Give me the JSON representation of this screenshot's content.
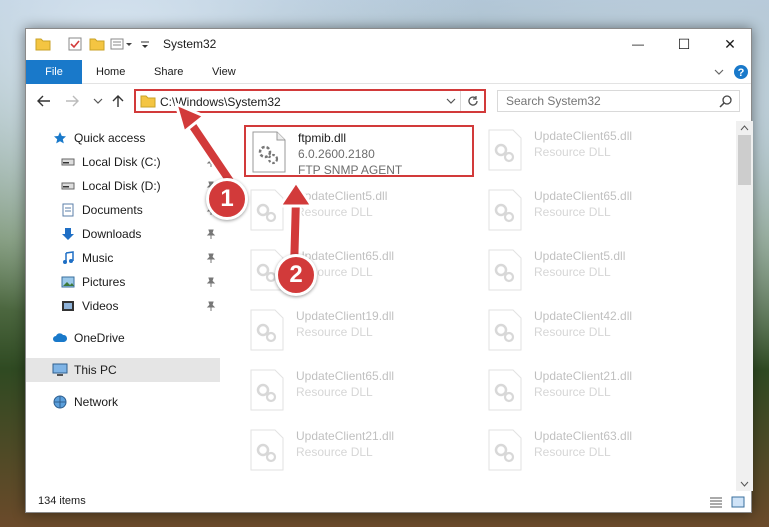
{
  "window": {
    "title": "System32",
    "minimize_glyph": "—",
    "maximize_glyph": "☐",
    "close_glyph": "✕"
  },
  "ribbon": {
    "tabs": [
      "File",
      "Home",
      "Share",
      "View"
    ]
  },
  "nav": {
    "address": "C:\\Windows\\System32",
    "search_placeholder": "Search System32"
  },
  "sidebar": {
    "items": [
      {
        "label": "Quick access",
        "icon": "star-icon"
      },
      {
        "label": "Local Disk (C:)",
        "icon": "drive-icon"
      },
      {
        "label": "Local Disk (D:)",
        "icon": "drive-icon"
      },
      {
        "label": "Documents",
        "icon": "documents-icon"
      },
      {
        "label": "Downloads",
        "icon": "download-icon"
      },
      {
        "label": "Music",
        "icon": "music-icon"
      },
      {
        "label": "Pictures",
        "icon": "pictures-icon"
      },
      {
        "label": "Videos",
        "icon": "videos-icon"
      },
      {
        "label": "OneDrive",
        "icon": "cloud-icon"
      },
      {
        "label": "This PC",
        "icon": "computer-icon"
      },
      {
        "label": "Network",
        "icon": "network-icon"
      }
    ]
  },
  "files": [
    {
      "name": "ftpmib.dll",
      "version": "6.0.2600.2180",
      "desc": "FTP SNMP AGENT"
    },
    {
      "name": "UpdateClient65.dll",
      "desc": "Resource DLL"
    },
    {
      "name": "UpdateClient5.dll",
      "desc": "Resource DLL"
    },
    {
      "name": "UpdateClient65.dll",
      "desc": "Resource DLL"
    },
    {
      "name": "UpdateClient65.dll",
      "desc": "Resource DLL"
    },
    {
      "name": "UpdateClient5.dll",
      "desc": "Resource DLL"
    },
    {
      "name": "UpdateClient19.dll",
      "desc": "Resource DLL"
    },
    {
      "name": "UpdateClient42.dll",
      "desc": "Resource DLL"
    },
    {
      "name": "UpdateClient65.dll",
      "desc": "Resource DLL"
    },
    {
      "name": "UpdateClient21.dll",
      "desc": "Resource DLL"
    },
    {
      "name": "UpdateClient21.dll",
      "desc": "Resource DLL"
    },
    {
      "name": "UpdateClient63.dll",
      "desc": "Resource DLL"
    }
  ],
  "status": {
    "item_count": "134 items"
  },
  "annotations": {
    "step1": "1",
    "step2": "2"
  },
  "colors": {
    "accent": "#1979ca",
    "highlight": "#d23a3a"
  }
}
